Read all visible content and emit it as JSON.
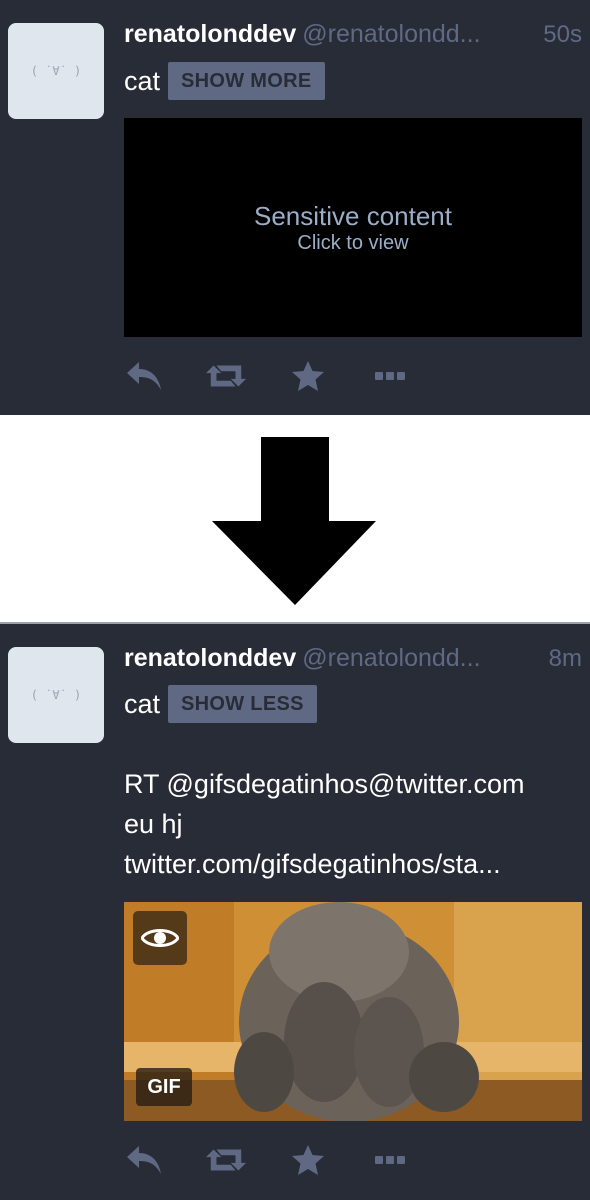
{
  "top_status": {
    "display_name": "renatolonddev",
    "acct": "@renatolondd...",
    "time": "50s",
    "avatar_text": "( ˙∀˙ )",
    "spoiler_text": "cat",
    "toggle_label": "SHOW MORE",
    "sensitive_title": "Sensitive content",
    "sensitive_subtitle": "Click to view"
  },
  "bottom_status": {
    "display_name": "renatolonddev",
    "acct": "@renatolondd...",
    "time": "8m",
    "avatar_text": "( ˙∀˙ )",
    "spoiler_text": "cat",
    "toggle_label": "SHOW LESS",
    "content_lines": [
      "RT @gifsdegatinhos@twitter.com",
      "eu hj",
      "twitter.com/gifsdegatinhos/sta..."
    ],
    "media_badge": "GIF"
  },
  "icons": {
    "reply": "reply-icon",
    "boost": "boost-icon",
    "favourite": "star-icon",
    "more": "more-icon",
    "hide_media": "eye-icon",
    "transition": "arrow-down-icon"
  },
  "colors": {
    "background": "#282c37",
    "muted": "#606984",
    "sensitive_text": "#9baec8",
    "avatar_bg": "#dfe6ee"
  }
}
